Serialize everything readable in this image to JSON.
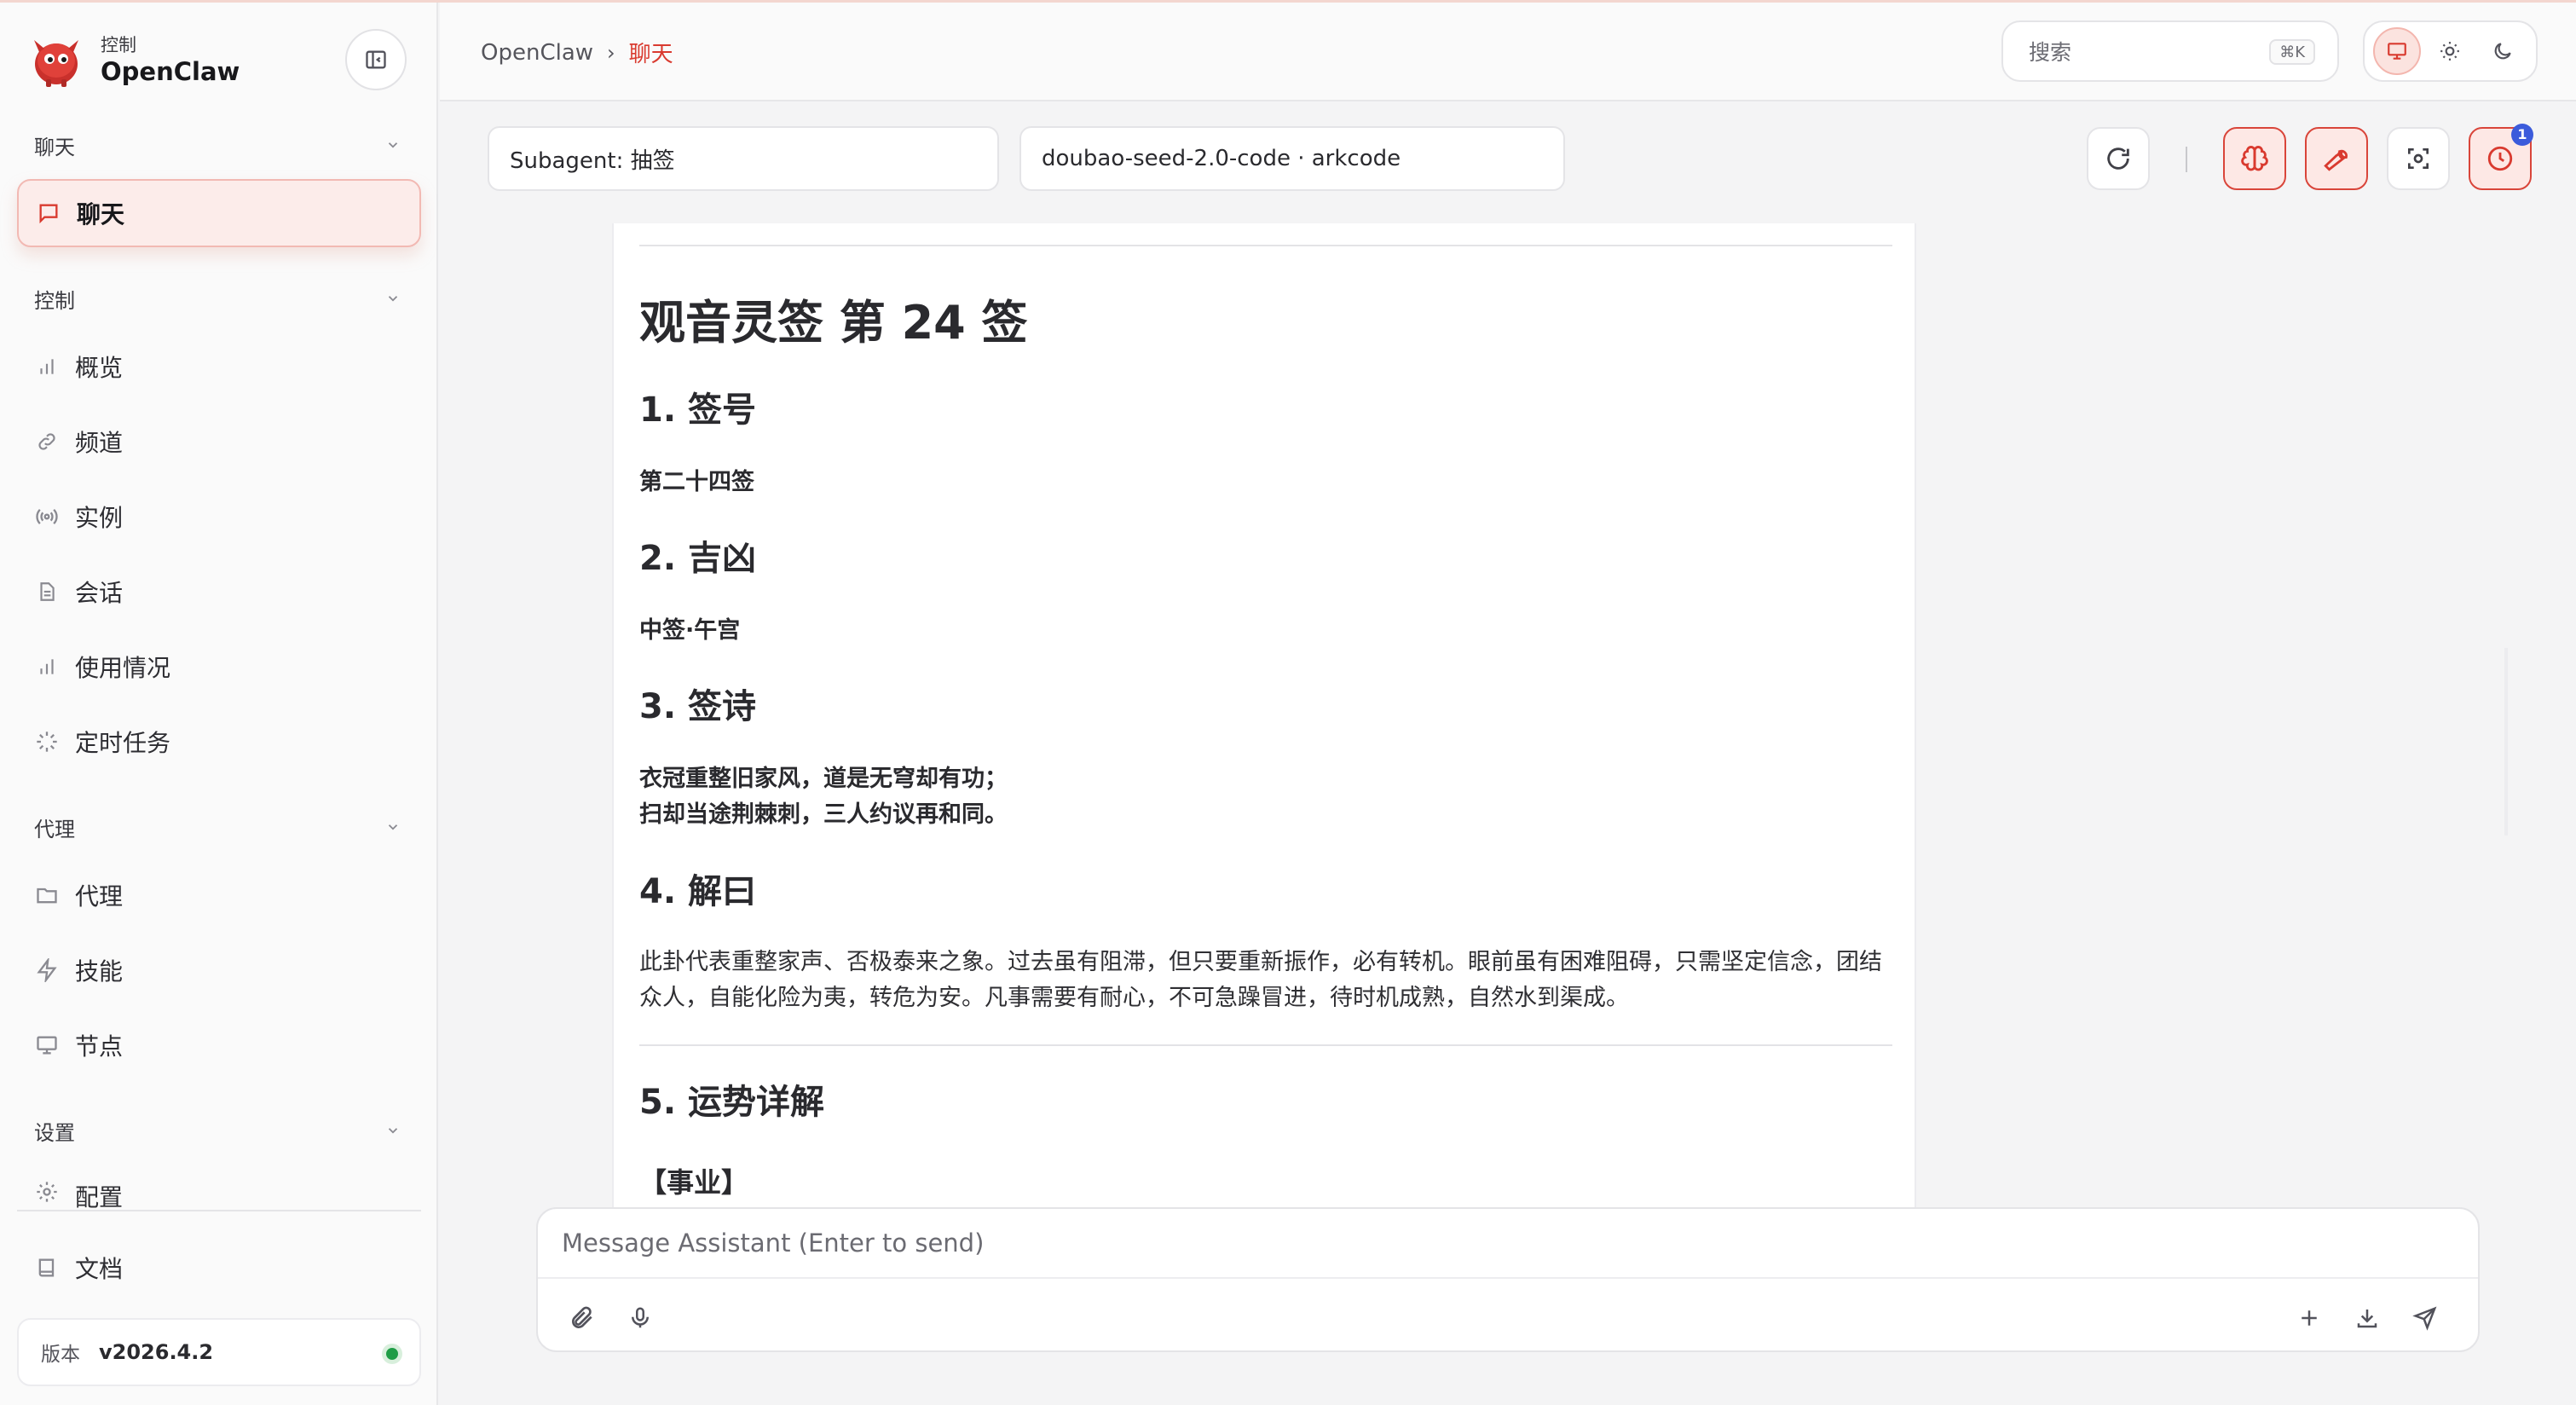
{
  "app": {
    "brand_sub": "控制",
    "brand_name": "OpenClaw",
    "accent_color": "#d93a2f"
  },
  "sidebar": {
    "sections": [
      {
        "title": "聊天",
        "items": [
          {
            "label": "聊天",
            "icon": "message-square-icon",
            "active": true
          }
        ]
      },
      {
        "title": "控制",
        "items": [
          {
            "label": "概览",
            "icon": "bar-chart-icon"
          },
          {
            "label": "频道",
            "icon": "link-icon"
          },
          {
            "label": "实例",
            "icon": "radio-icon"
          },
          {
            "label": "会话",
            "icon": "file-text-icon"
          },
          {
            "label": "使用情况",
            "icon": "bar-chart-icon"
          },
          {
            "label": "定时任务",
            "icon": "loader-icon"
          }
        ]
      },
      {
        "title": "代理",
        "items": [
          {
            "label": "代理",
            "icon": "folder-icon"
          },
          {
            "label": "技能",
            "icon": "zap-icon"
          },
          {
            "label": "节点",
            "icon": "monitor-icon"
          }
        ]
      },
      {
        "title": "设置",
        "items": [
          {
            "label": "配置",
            "icon": "gear-icon"
          },
          {
            "label": "文档",
            "icon": "book-icon"
          }
        ]
      }
    ],
    "version_label": "版本",
    "version_value": "v2026.4.2",
    "status_color": "#1f9d46"
  },
  "topbar": {
    "breadcrumb_root": "OpenClaw",
    "breadcrumb_separator": "›",
    "breadcrumb_current": "聊天",
    "search_placeholder": "搜索",
    "search_shortcut": "⌘K"
  },
  "session": {
    "agent_selector": "Subagent: 抽签",
    "model_selector": "doubao-seed-2.0-code · arkcode",
    "cron_badge": "1"
  },
  "message": {
    "title": "观音灵签 第 24 签",
    "sections": [
      {
        "heading": "1. 签号",
        "body": "第二十四签"
      },
      {
        "heading": "2. 吉凶",
        "body": "中签·午宫"
      },
      {
        "heading": "3. 签诗",
        "lines": [
          "衣冠重整旧家风，道是无穹却有功；",
          "扫却当途荆棘刺，三人约议再和同。"
        ]
      },
      {
        "heading": "4. 解曰",
        "body": "此卦代表重整家声、否极泰来之象。过去虽有阻滞，但只要重新振作，必有转机。眼前虽有困难阻碍，只需坚定信念，团结众人，自能化险为夷，转危为安。凡事需要有耐心，不可急躁冒进，待时机成熟，自然水到渠成。"
      },
      {
        "heading": "5. 运势详解",
        "sub": "【事业】"
      }
    ]
  },
  "composer": {
    "placeholder": "Message Assistant (Enter to send)"
  }
}
